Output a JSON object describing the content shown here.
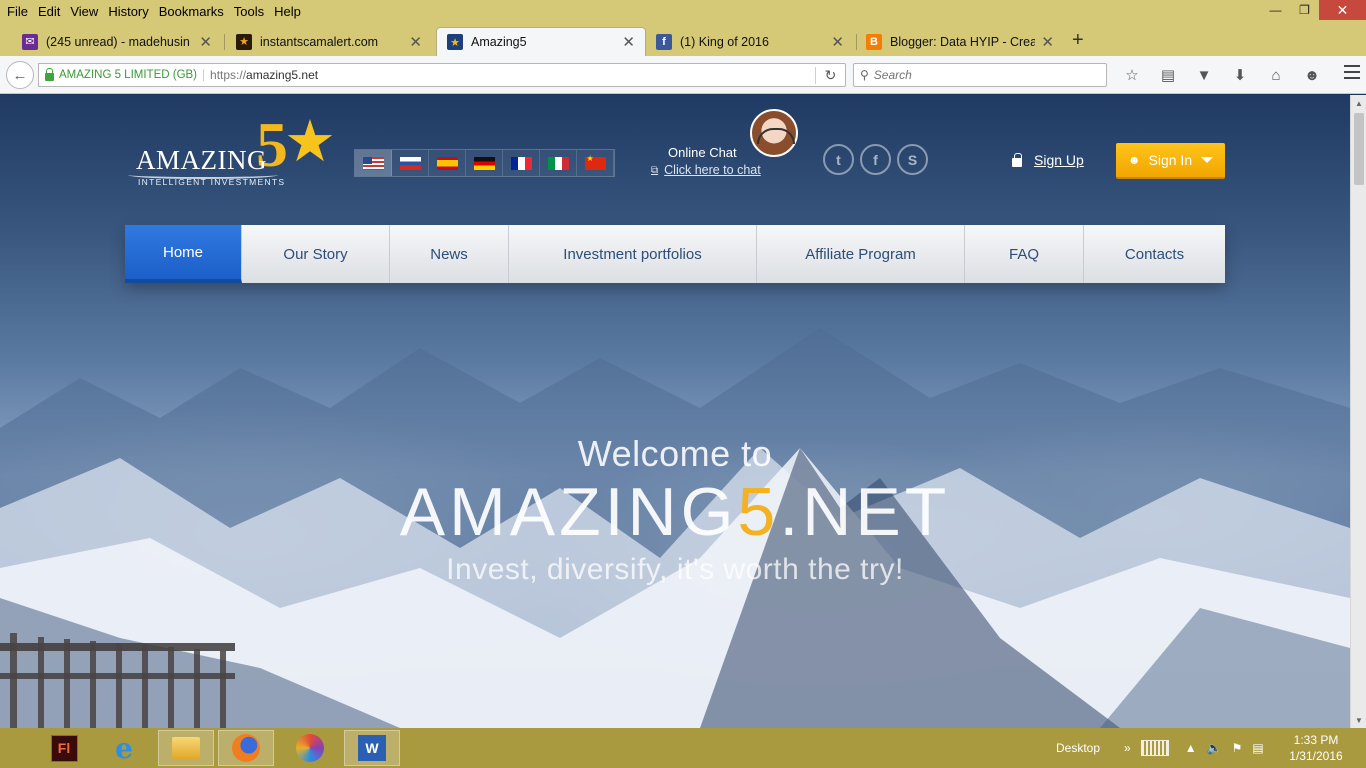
{
  "menu": [
    "File",
    "Edit",
    "View",
    "History",
    "Bookmarks",
    "Tools",
    "Help"
  ],
  "tabs": [
    {
      "title": "(245 unread) - madehusin ...",
      "icon": "mail-icon",
      "color": "#6b2c91"
    },
    {
      "title": "instantscamalert.com",
      "icon": "star-icon",
      "color": "#2a1a0a"
    },
    {
      "title": "Amazing5",
      "icon": "star-icon",
      "color": "#1d3f7a",
      "active": true
    },
    {
      "title": "(1) King of 2016",
      "icon": "facebook-icon",
      "color": "#3b5998"
    },
    {
      "title": "Blogger: Data HYIP - Creat...",
      "icon": "blogger-icon",
      "color": "#f57d00"
    }
  ],
  "address": {
    "identity": "AMAZING 5 LIMITED (GB)",
    "scheme": "https://",
    "host": "amazing5.net"
  },
  "search": {
    "placeholder": "Search"
  },
  "site": {
    "logo": {
      "word": "AMAZING",
      "five": "5",
      "tagline": "INTELLIGENT INVESTMENTS"
    },
    "languages": [
      "English",
      "Russian",
      "Spanish",
      "German",
      "French",
      "Italian",
      "Chinese"
    ],
    "chat": {
      "label": "Online Chat",
      "link": "Click here to chat"
    },
    "socials": [
      "twitter-icon",
      "facebook-icon",
      "skype-icon"
    ],
    "signup": "Sign Up",
    "signin": "Sign In",
    "accent": "#f3b124"
  },
  "nav": [
    {
      "label": "Home",
      "active": true
    },
    {
      "label": "Our Story"
    },
    {
      "label": "News"
    },
    {
      "label": "Investment portfolios"
    },
    {
      "label": "Affiliate Program"
    },
    {
      "label": "FAQ"
    },
    {
      "label": "Contacts"
    }
  ],
  "hero": {
    "welcome": "Welcome to",
    "brand_prefix": "AMAZING",
    "brand_five": "5",
    "brand_suffix": ".NET",
    "tagline": "Invest, diversify, it's worth the try!"
  },
  "taskbar": {
    "desktop": "Desktop",
    "time": "1:33 PM",
    "date": "1/31/2016"
  }
}
